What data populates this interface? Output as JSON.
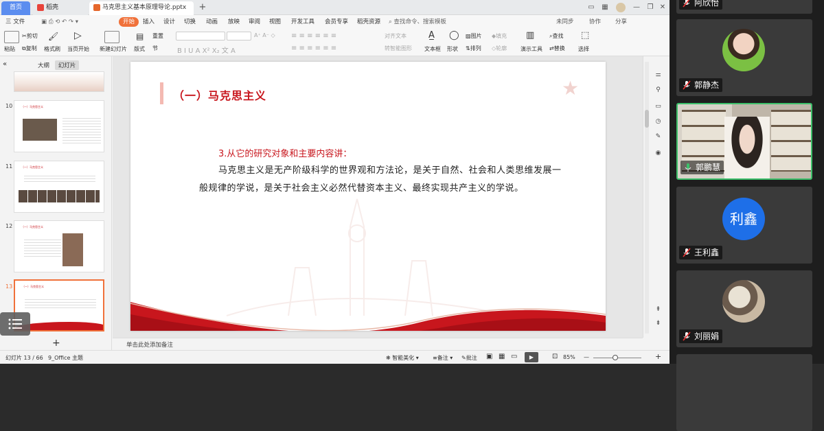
{
  "titlebar": {
    "home_tab": "首页",
    "draw_tab": "稻壳",
    "doc_tab": "马克思主义基本原理导论.pptx"
  },
  "menu": {
    "file": "三 文件",
    "items": [
      "开始",
      "插入",
      "设计",
      "切换",
      "动画",
      "放映",
      "审阅",
      "视图",
      "开发工具",
      "会员专享",
      "稻壳资源"
    ],
    "search_placeholder": "查找命令、搜索模板",
    "right": [
      "未同步",
      "协作",
      "分享"
    ]
  },
  "ribbon": {
    "paste": "粘贴",
    "cut": "剪切",
    "copy": "复制",
    "format_painter": "格式刷",
    "from_current": "当页开始",
    "new_slide": "新建幻灯片",
    "layout": "版式",
    "section": "节",
    "reset": "重置",
    "textbox": "文本框",
    "shape": "形状",
    "arrange": "排列",
    "picture": "图片",
    "fill": "填充",
    "outline": "轮廓",
    "presenter_tools": "演示工具",
    "find": "查找",
    "replace": "替换",
    "select": "选择",
    "convert_smartart": "转智能图形",
    "text_align": "对齐文本"
  },
  "leftpanel": {
    "tab_outline": "大纲",
    "tab_slides": "幻灯片",
    "thumbs": [
      {
        "num": "10",
        "title": "（一）马克思主义"
      },
      {
        "num": "11",
        "title": "（一）马克思主义"
      },
      {
        "num": "12",
        "title": "（一）马克思主义"
      },
      {
        "num": "13",
        "title": "（一）马克思主义"
      }
    ],
    "add": "+"
  },
  "slide": {
    "title": "（一）马克思主义",
    "subtitle": "3.从它的研究对象和主要内容讲：",
    "body": "马克思主义是无产阶级科学的世界观和方法论，是关于自然、社会和人类思维发展一般规律的学说，是关于社会主义必然代替资本主义、最终实现共产主义的学说。"
  },
  "notes": {
    "placeholder": "单击此处添加备注"
  },
  "status": {
    "slide_count": "幻灯片 13 / 66",
    "theme": "9_Office 主题",
    "smart_beautify": "智能美化",
    "notes": "备注",
    "comments": "批注",
    "zoom": "85%"
  },
  "participants": [
    {
      "name": "阿欣怡",
      "muted": true
    },
    {
      "name": "郭静杰",
      "muted": true
    },
    {
      "name": "郭鹏慧",
      "muted": false
    },
    {
      "name": "王利鑫",
      "muted": true,
      "initials": "利鑫"
    },
    {
      "name": "刘丽娟",
      "muted": true
    }
  ],
  "colors": {
    "accent": "#f0713a",
    "slide_red": "#c8161d",
    "speaking": "#3cc06a",
    "avatar_blue": "#1e6fe8"
  }
}
